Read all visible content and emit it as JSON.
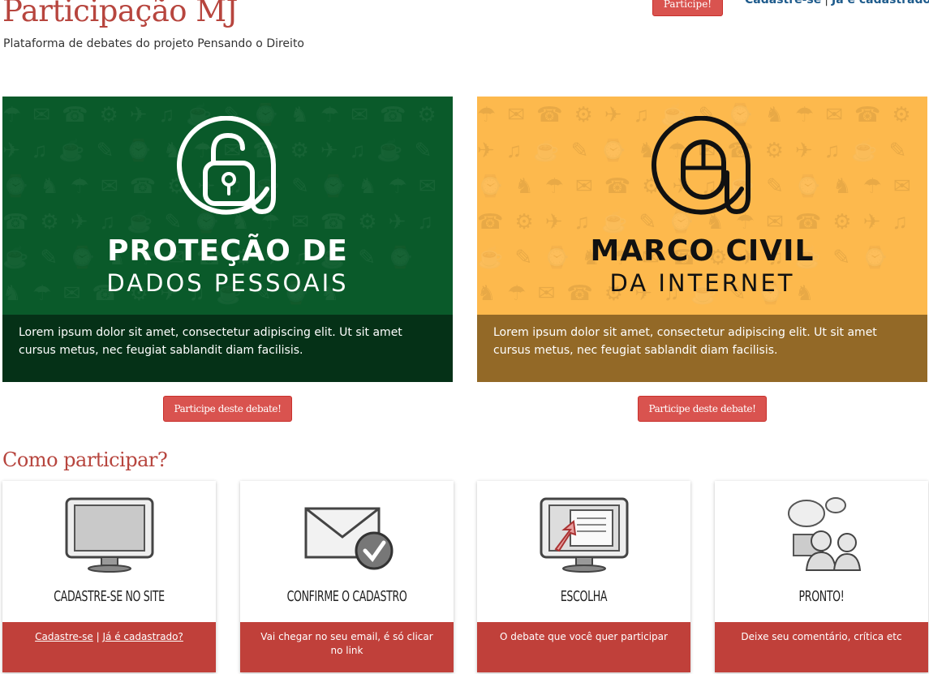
{
  "header": {
    "title": "Participação MJ",
    "subtitle": "Plataforma de debates do projeto Pensando o Direito",
    "participate_button": "Participe!",
    "register_link": "Cadastre-se",
    "separator": "|",
    "login_link": "Já é cadastrado?"
  },
  "debates": [
    {
      "title_bold": "PROTEÇÃO DE",
      "title_light": "DADOS PESSOAIS",
      "caption": "Lorem ipsum dolor sit amet, consectetur adipiscing elit. Ut sit amet cursus metus, nec feugiat sablandit diam facilisis.",
      "button": "Participe deste debate!",
      "color": "#0a5a2a",
      "icon": "lock-at-icon"
    },
    {
      "title_bold": "MARCO CIVIL",
      "title_light": "DA INTERNET",
      "caption": "Lorem ipsum dolor sit amet, consectetur adipiscing elit. Ut sit amet cursus metus, nec feugiat sablandit diam facilisis.",
      "button": "Participe deste debate!",
      "color": "#fdb94d",
      "icon": "mouse-at-icon"
    }
  ],
  "how_to": {
    "title": "Como participar?",
    "steps": [
      {
        "title": "Cadastre-se no site",
        "foot_link1": "Cadastre-se",
        "foot_sep": "|",
        "foot_link2": "Já é cadastrado?",
        "icon": "monitor-icon"
      },
      {
        "title": "Confirme o cadastro",
        "foot": "Vai chegar no seu email, é só clicar no link",
        "icon": "envelope-check-icon"
      },
      {
        "title": "Escolha",
        "foot": "O debate que você quer participar",
        "icon": "monitor-pointer-icon"
      },
      {
        "title": "Pronto!",
        "foot": "Deixe seu comentário, crítica etc",
        "icon": "people-chat-icon"
      }
    ]
  },
  "colors": {
    "accent": "#d9534f",
    "title_red": "#b7453e",
    "link_blue": "#1e5b8c",
    "footer_red": "#c0403a"
  }
}
